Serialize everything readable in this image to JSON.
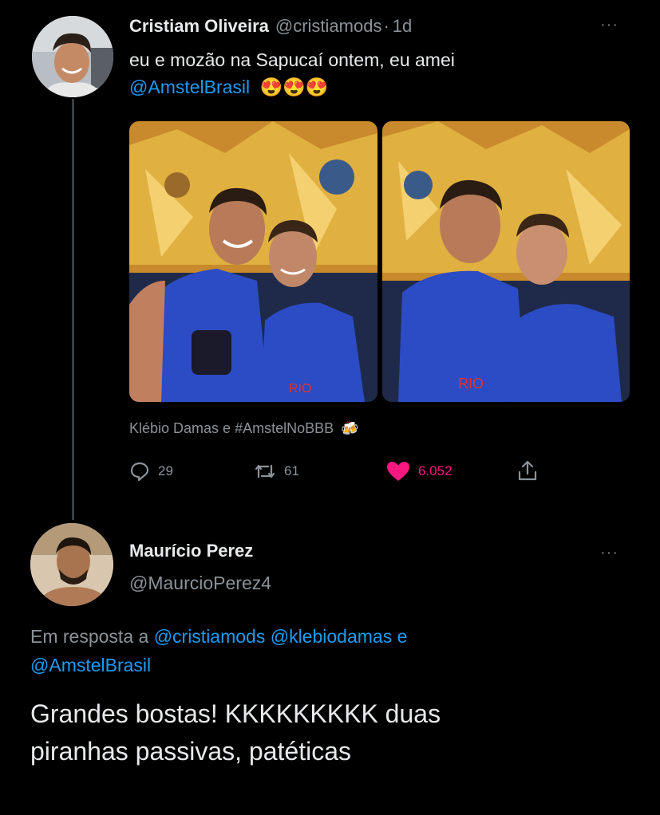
{
  "tweet": {
    "author_name": "Cristiam Oliveira",
    "author_handle": "@cristiamods",
    "separator": "·",
    "time": "1d",
    "text_line1": "eu e mozão na Sapucaí ontem, eu amei",
    "mention": "@AmstelBrasil",
    "emojis": "😍😍😍",
    "tagged": "Klébio Damas e #AmstelNoBBB",
    "tag_emoji": "🍻",
    "photos": [
      {
        "description": "two-men-smiling-carnival"
      },
      {
        "description": "man-kissing-cheek-carnival"
      }
    ],
    "actions": {
      "replies": "29",
      "retweets": "61",
      "likes": "6.052"
    }
  },
  "reply": {
    "author_name": "Maurício Perez",
    "author_handle": "@MaurcioPerez4",
    "reply_to_prefix": "Em resposta a",
    "reply_to_users": "@cristiamods @klebiodamas",
    "reply_to_and": "e",
    "reply_to_last": "@AmstelBrasil",
    "text_line1": "Grandes bostas! KKKKKKKKK duas",
    "text_line2": "piranhas passivas, patéticas"
  },
  "colors": {
    "background": "#000000",
    "text": "#e7e9ea",
    "muted": "#8b9298",
    "link": "#1d9bf0",
    "like": "#f91880"
  }
}
